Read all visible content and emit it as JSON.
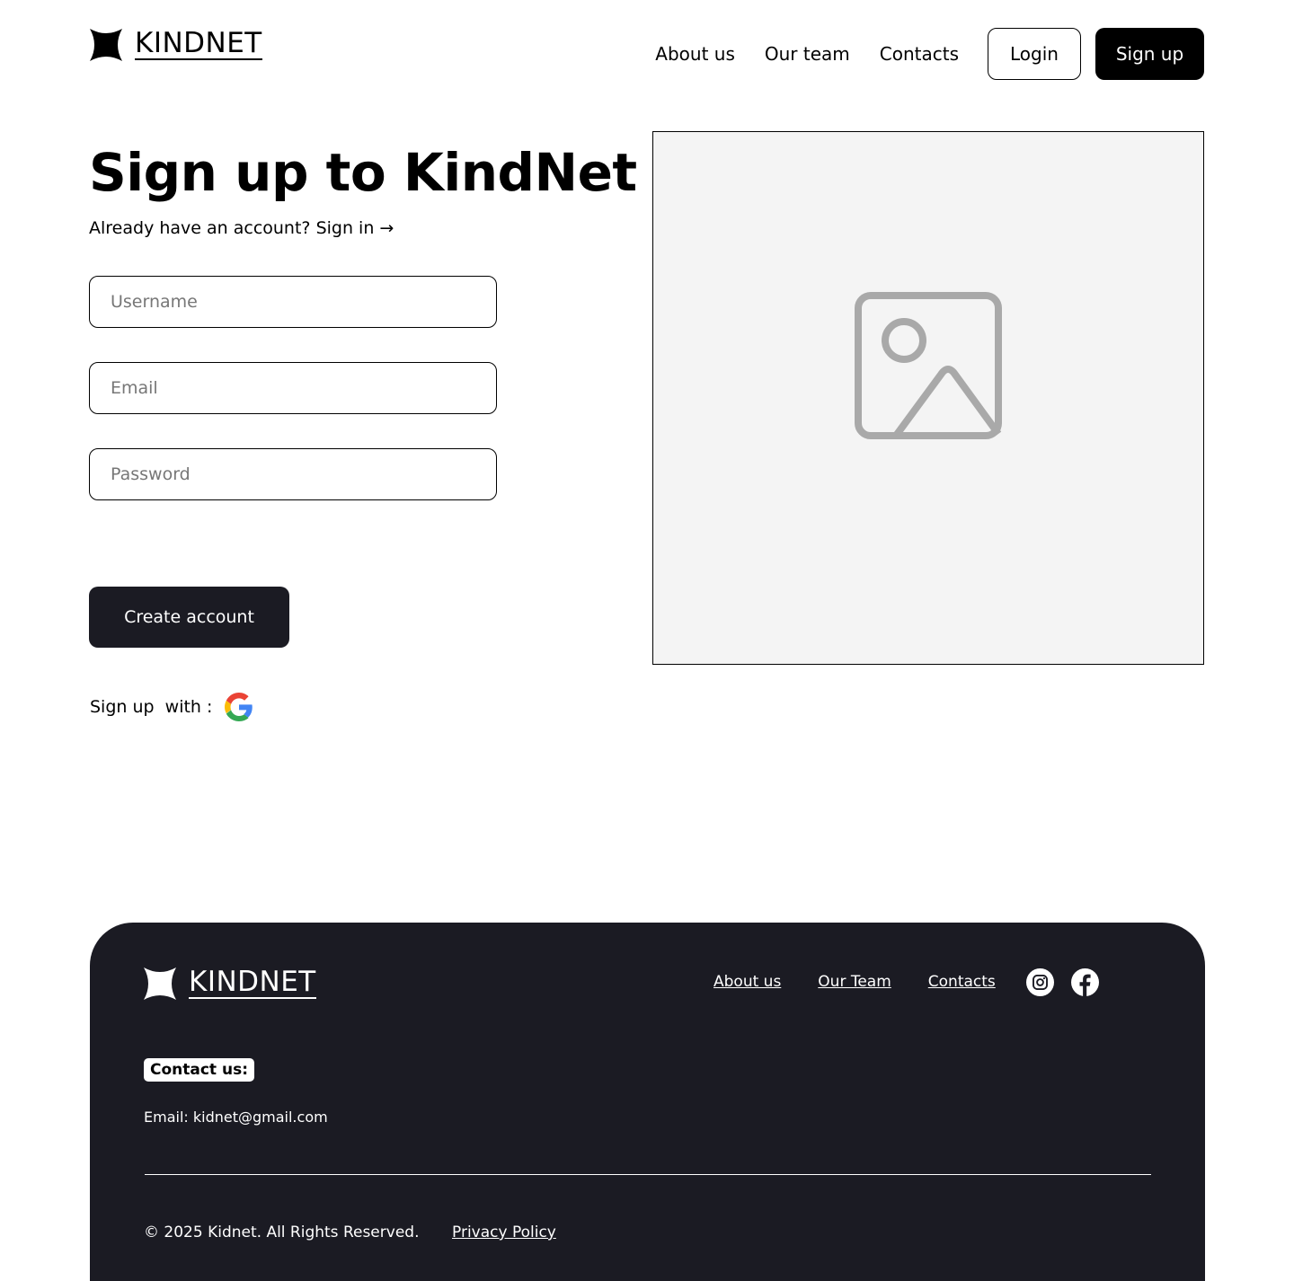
{
  "brand": {
    "name": "KINDNET",
    "logo_icon": "four-point-star-icon"
  },
  "header": {
    "nav": [
      "About us",
      "Our team",
      "Contacts"
    ],
    "login_label": "Login",
    "signup_label": "Sign up"
  },
  "main": {
    "title": "Sign up to KindNet",
    "subtitle_prefix": "Already have an account?",
    "signin_link": "Sign in →",
    "fields": {
      "username_placeholder": "Username",
      "email_placeholder": "Email",
      "password_placeholder": "Password"
    },
    "create_label": "Create account",
    "social_label": "Sign up  with :",
    "social_icon": "google-icon",
    "image_icon": "image-placeholder-icon"
  },
  "footer": {
    "nav": [
      "About us",
      "Our Team",
      "Contacts"
    ],
    "social_icons": [
      "instagram-icon",
      "facebook-icon"
    ],
    "contact_heading": "Contact us:",
    "email_line": "Email: kidnet@gmail.com",
    "copyright": "© 2025 Kidnet. All Rights Reserved.",
    "privacy": "Privacy Policy"
  },
  "colors": {
    "primary": "#000000",
    "dark": "#1b1b23",
    "placeholder_bg": "#f4f4f4",
    "icon_gray": "#a9a9a9"
  }
}
